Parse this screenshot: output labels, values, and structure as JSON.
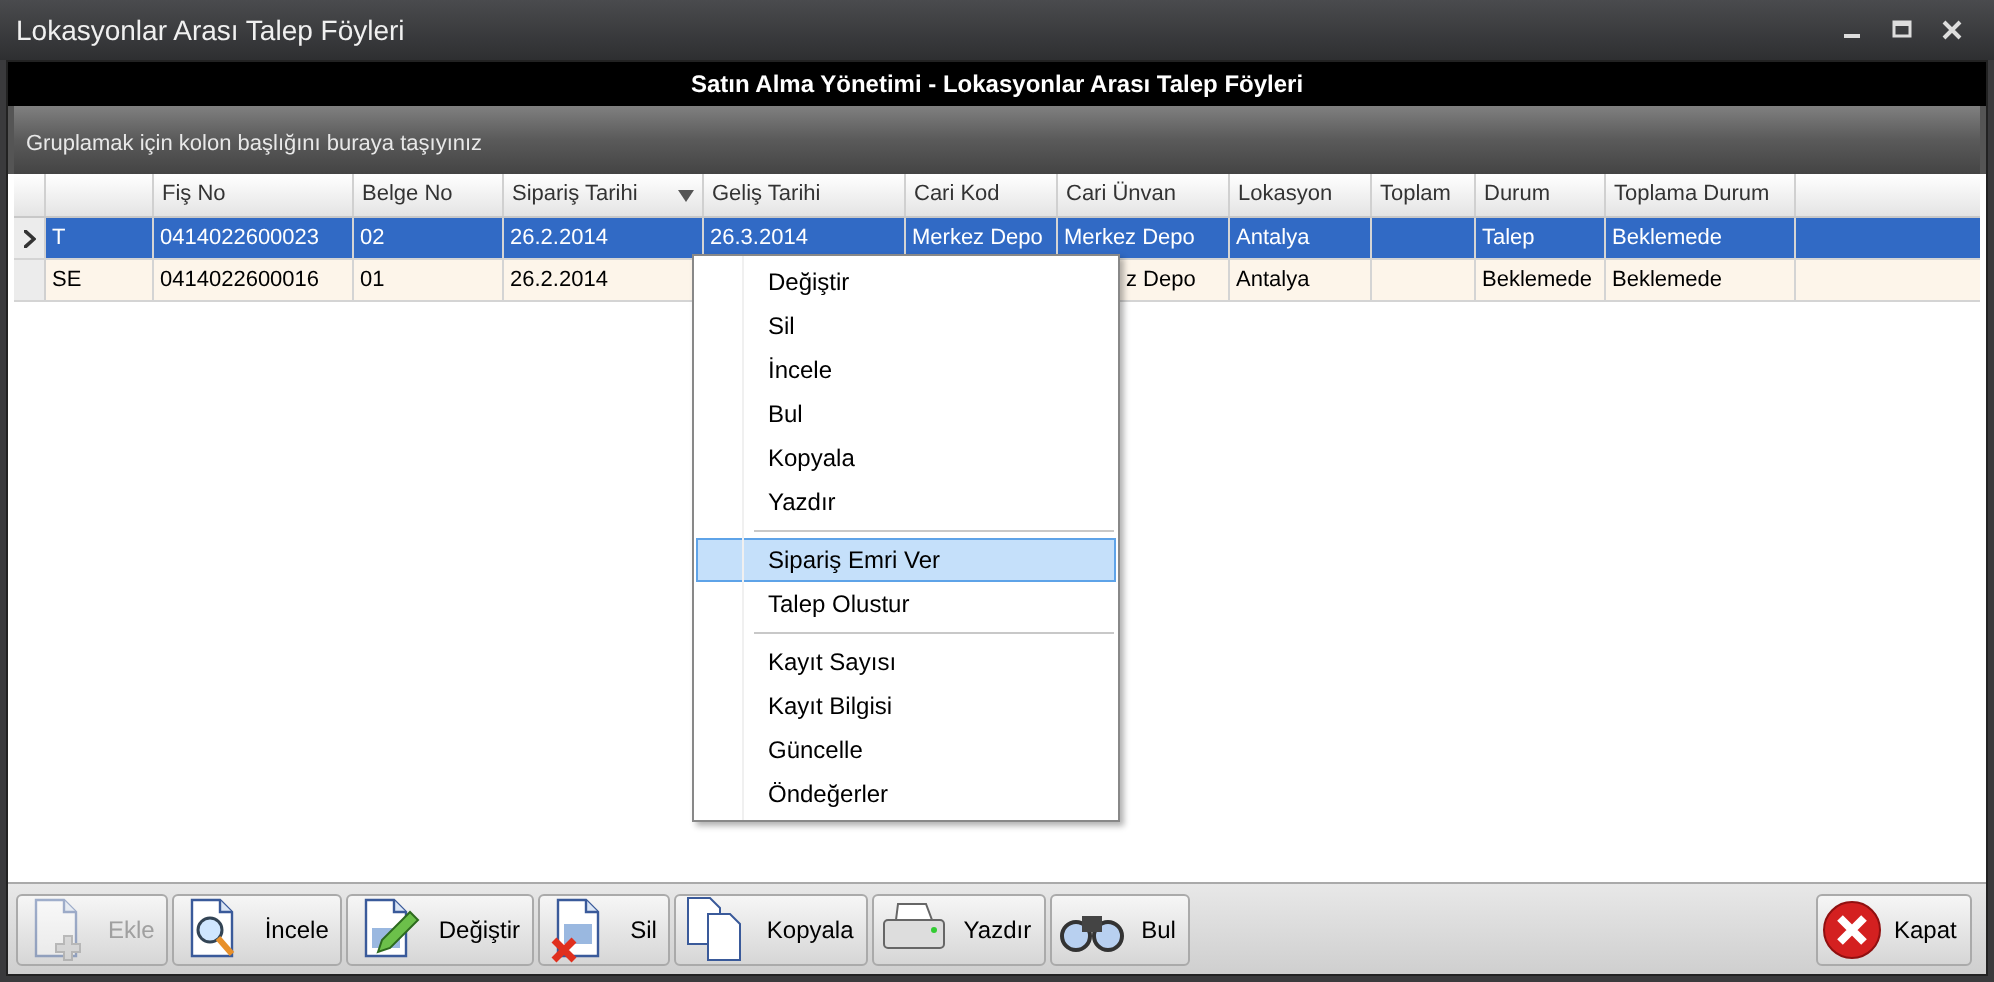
{
  "window": {
    "title": "Lokasyonlar Arası Talep Föyleri",
    "controls": [
      {
        "kind": "minimize"
      },
      {
        "kind": "maximize"
      },
      {
        "kind": "close"
      }
    ]
  },
  "header": {
    "title": "Satın Alma Yönetimi - Lokasyonlar Arası Talep Föyleri"
  },
  "group_panel": {
    "hint": "Gruplamak için kolon başlığını buraya taşıyınız"
  },
  "table": {
    "columns": [
      {
        "sorted": false
      },
      {
        "label": "Fiş No",
        "sorted": false
      },
      {
        "label": "Belge No",
        "sorted": false
      },
      {
        "label": "Sipariş Tarihi",
        "sorted": true
      },
      {
        "label": "Geliş Tarihi",
        "sorted": false
      },
      {
        "label": "Cari Kod",
        "sorted": false
      },
      {
        "label": "Cari Ünvan",
        "sorted": false
      },
      {
        "label": "Lokasyon",
        "sorted": false
      },
      {
        "label": "Toplam",
        "sorted": false
      },
      {
        "label": "Durum",
        "sorted": false
      },
      {
        "label": "Toplama Durum",
        "sorted": false
      }
    ],
    "rows": [
      {
        "selected": true,
        "cells": [
          "T",
          "0414022600023",
          "02",
          "26.2.2014",
          "26.3.2014",
          "Merkez Depo",
          "Merkez Depo",
          "Antalya",
          null,
          "Talep",
          "Beklemede"
        ]
      },
      {
        "selected": false,
        "cells": [
          "SE",
          "0414022600016",
          "01",
          "26.2.2014",
          null,
          null,
          {
            "text": "z Depo",
            "covered": true
          },
          "Antalya",
          null,
          "Beklemede",
          "Beklemede"
        ]
      }
    ]
  },
  "context_menu": {
    "items": [
      {
        "kind": "item",
        "label": "Değiştir",
        "selected": false
      },
      {
        "kind": "item",
        "label": "Sil",
        "selected": false
      },
      {
        "kind": "item",
        "label": "İncele",
        "selected": false
      },
      {
        "kind": "item",
        "label": "Bul",
        "selected": false
      },
      {
        "kind": "item",
        "label": "Kopyala",
        "selected": false
      },
      {
        "kind": "item",
        "label": "Yazdır",
        "selected": false
      },
      {
        "kind": "separator"
      },
      {
        "kind": "item",
        "label": "Sipariş Emri Ver",
        "selected": true
      },
      {
        "kind": "item",
        "label": "Talep Olustur",
        "selected": false
      },
      {
        "kind": "separator"
      },
      {
        "kind": "item",
        "label": "Kayıt Sayısı",
        "selected": false
      },
      {
        "kind": "item",
        "label": "Kayıt Bilgisi",
        "selected": false
      },
      {
        "kind": "item",
        "label": "Güncelle",
        "selected": false
      },
      {
        "kind": "item",
        "label": "Öndeğerler",
        "selected": false
      }
    ]
  },
  "toolbar": {
    "buttons": [
      {
        "kind": "add",
        "label": "Ekle",
        "disabled": true
      },
      {
        "kind": "view",
        "label": "İncele",
        "disabled": false
      },
      {
        "kind": "edit",
        "label": "Değiştir",
        "disabled": false
      },
      {
        "kind": "delete",
        "label": "Sil",
        "disabled": false
      },
      {
        "kind": "copy",
        "label": "Kopyala",
        "disabled": false
      },
      {
        "kind": "print",
        "label": "Yazdır",
        "disabled": false
      },
      {
        "kind": "find",
        "label": "Bul",
        "disabled": false
      }
    ],
    "close_button": {
      "label": "Kapat"
    }
  }
}
